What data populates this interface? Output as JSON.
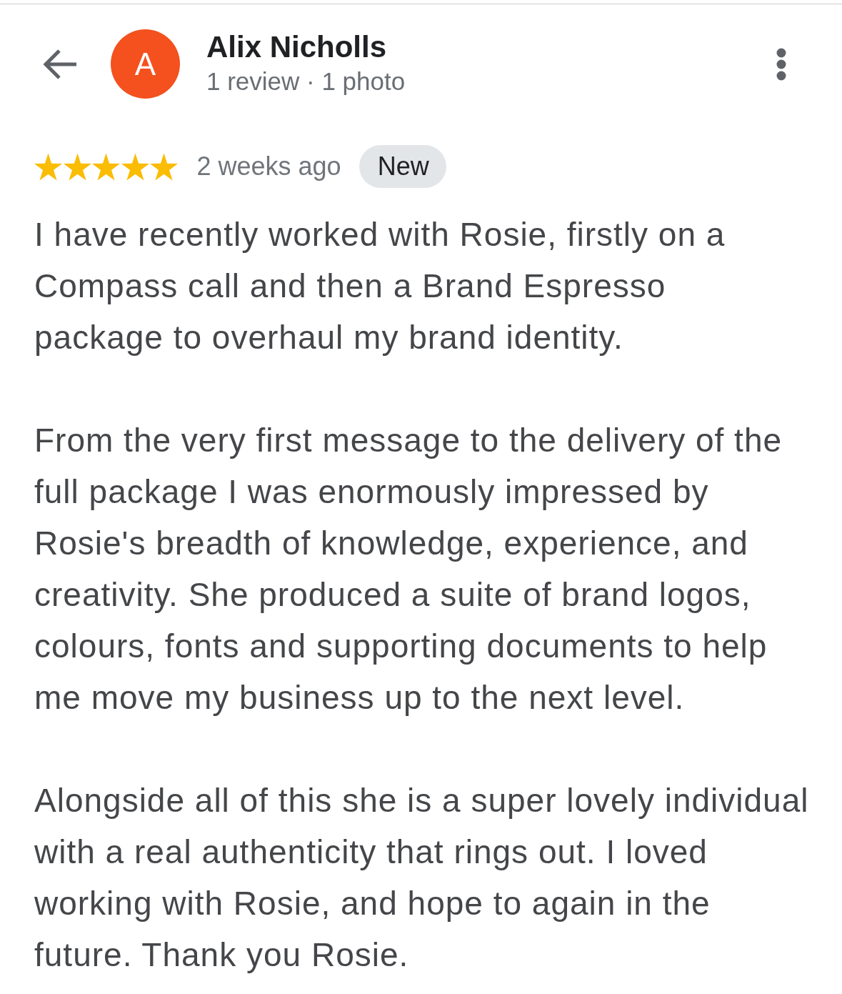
{
  "header": {
    "avatar_letter": "A",
    "name": "Alix Nicholls",
    "subtitle": "1 review · 1 photo"
  },
  "review": {
    "stars": 5,
    "time": "2 weeks ago",
    "badge": "New",
    "paragraphs": [
      "I have recently worked with Rosie, firstly on a\nCompass call and then a Brand Espresso\npackage to overhaul my brand identity.",
      "From the very first message to the delivery of the\nfull package I was enormously impressed by\nRosie's breadth of knowledge, experience, and\ncreativity. She produced a suite of brand logos,\ncolours, fonts and supporting documents to help\nme move my business up to the next level.",
      "Alongside all of this she is a super lovely individual\nwith a real authenticity that rings out. I loved\nworking with Rosie, and hope to again in the\nfuture. Thank you Rosie."
    ]
  }
}
